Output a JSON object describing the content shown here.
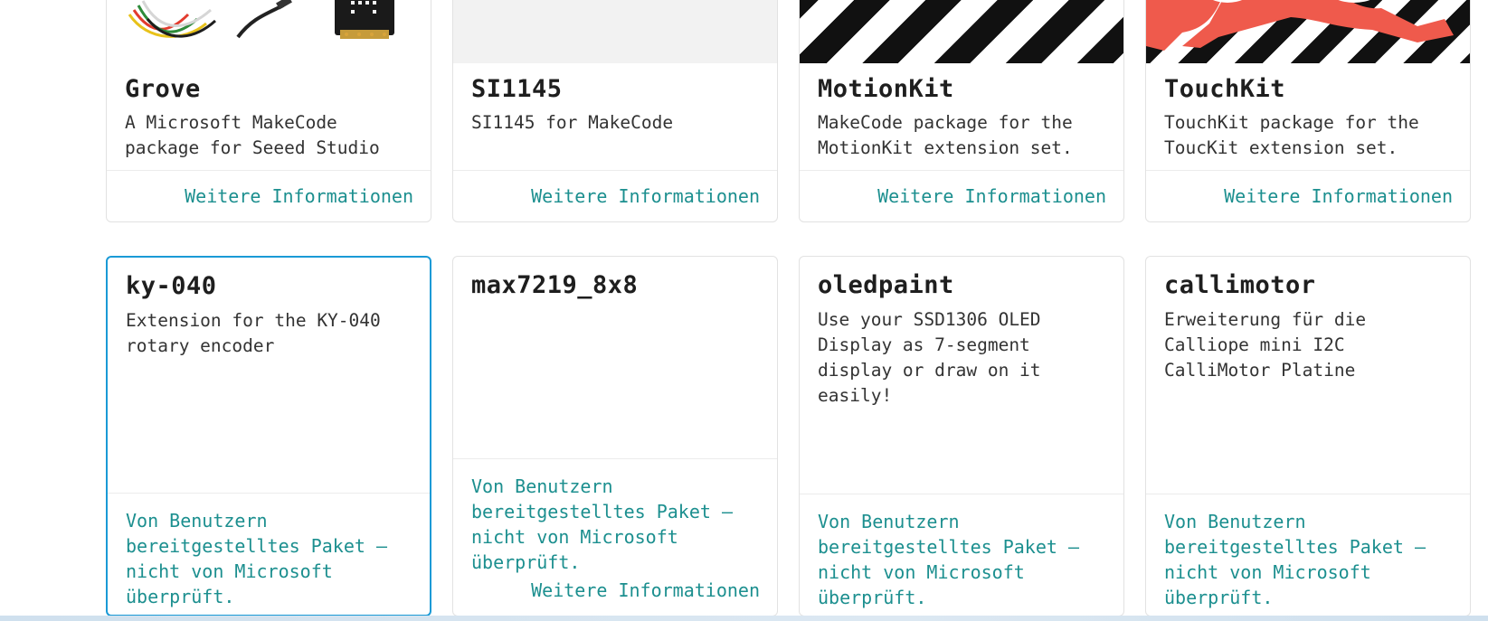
{
  "top_row": [
    {
      "title": "Grove",
      "description": "A Microsoft MakeCode package for Seeed Studio",
      "link": "Weitere Informationen",
      "image": "grove-hardware-photo"
    },
    {
      "title": "SI1145",
      "description": "SI1145 for MakeCode",
      "link": "Weitere Informationen",
      "image": "blank-placeholder"
    },
    {
      "title": "MotionKit",
      "description": "MakeCode package for the MotionKit extension set.",
      "link": "Weitere Informationen",
      "image": "black-white-stripes"
    },
    {
      "title": "TouchKit",
      "description": "TouchKit package for the ToucKit extension set.",
      "link": "Weitere Informationen",
      "image": "red-shapes-on-stripes"
    }
  ],
  "bottom_row": [
    {
      "title": "ky-040",
      "description": "Extension for the KY-040 rotary encoder",
      "warning": "Von Benutzern bereitgestelltes Paket – nicht von Microsoft überprüft."
    },
    {
      "title": "max7219_8x8",
      "description": "",
      "warning": "Von Benutzern bereitgestelltes Paket – nicht von Microsoft überprüft.",
      "link": "Weitere Informationen"
    },
    {
      "title": "oledpaint",
      "description": "Use your SSD1306 OLED Display as 7-segment display or draw on it easily!",
      "warning": "Von Benutzern bereitgestelltes Paket – nicht von Microsoft überprüft."
    },
    {
      "title": "callimotor",
      "description": "Erweiterung für die Calliope mini I2C CalliMotor Platine",
      "warning": "Von Benutzern bereitgestelltes Paket – nicht von Microsoft überprüft."
    }
  ],
  "colors": {
    "accent_link": "#1c8f8f",
    "selected_border": "#1a9ad6"
  }
}
